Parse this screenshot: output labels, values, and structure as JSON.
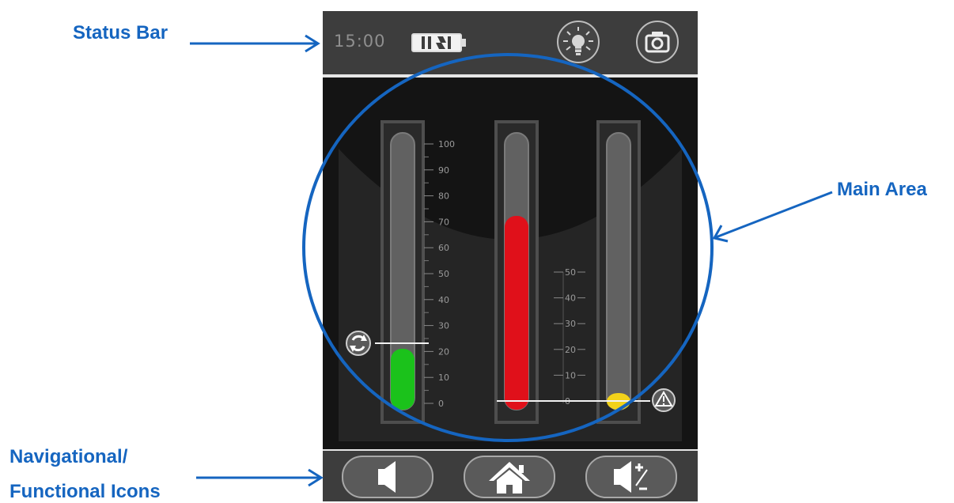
{
  "annotations": {
    "status_bar": "Status Bar",
    "main_area": "Main Area",
    "nav_line1": "Navigational/",
    "nav_line2": "Functional Icons"
  },
  "status": {
    "time": "15:00",
    "battery_icon": "battery-icon",
    "light_icon": "lightbulb-icon",
    "camera_icon": "camera-icon"
  },
  "gauges": {
    "left": {
      "fill_percent": 22,
      "color": "#1bc21b",
      "scale_labels": [
        "100",
        "90",
        "80",
        "70",
        "60",
        "50",
        "40",
        "30",
        "20",
        "10",
        "0"
      ]
    },
    "middle": {
      "fill_percent": 70,
      "color": "#e0101a"
    },
    "right": {
      "fill_percent": 3,
      "color": "#f2d21a"
    },
    "mid_scale_labels": [
      "50",
      "40",
      "30",
      "20",
      "10",
      "0"
    ]
  },
  "nav": {
    "left_icon": "speaker-icon",
    "center_icon": "home-icon",
    "right_icon": "volume-adjust-icon"
  },
  "colors": {
    "annotation": "#1565c0",
    "green": "#1bc21b",
    "red": "#e0101a",
    "yellow": "#f2d21a"
  }
}
